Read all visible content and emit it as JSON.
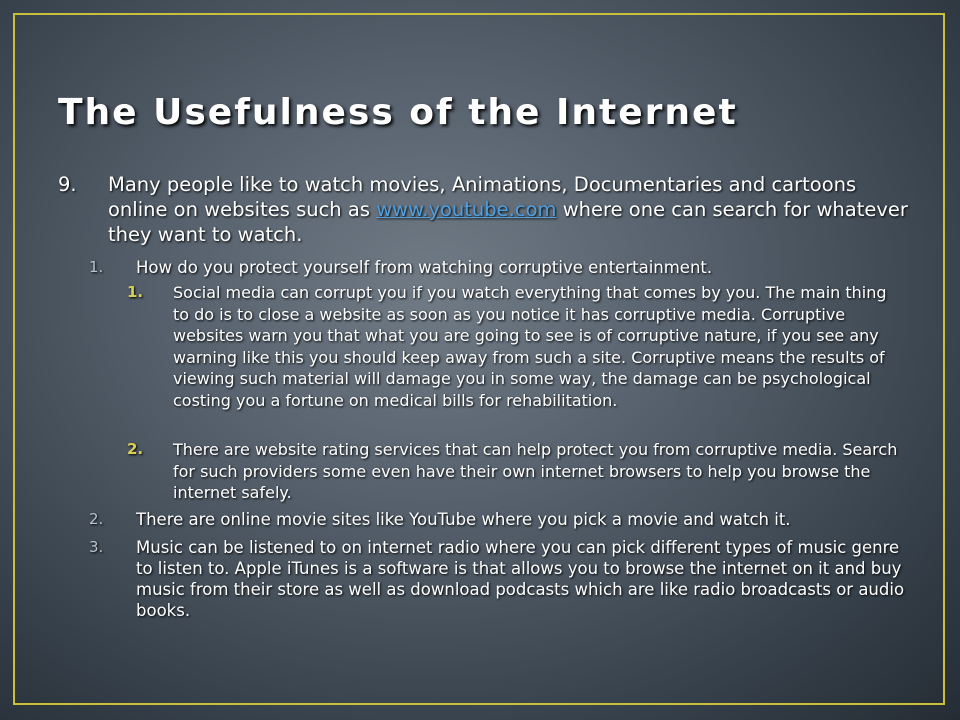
{
  "slide": {
    "title": "The Usefulness of the Internet",
    "point": {
      "number": "9.",
      "text_before": "Many people like to watch movies, Animations, Documentaries and cartoons online on websites such as ",
      "link": "www.youtube.com",
      "text_after": " where one can search for whatever they want to watch."
    },
    "sub_items": [
      {
        "number": "1.",
        "text": "How do you protect yourself from watching corruptive entertainment."
      },
      {
        "number": "2.",
        "text": "There are online movie sites like YouTube where you pick a movie and watch it."
      },
      {
        "number": "3.",
        "text": "Music can be listened to on internet radio where you can pick different types of music genre to listen to. Apple iTunes is a software is that allows you to browse the internet on it and buy music from their store as well as download podcasts which are like radio broadcasts or audio books."
      }
    ],
    "sub_sub_items": [
      {
        "number": "1.",
        "text": "Social media can corrupt you if  you watch everything that comes by you. The main thing to do is to close a website as soon as you notice it has corruptive media. Corruptive websites warn you that what you are going to see is of corruptive nature, if you see any warning like this you should keep away from such a site. Corruptive means the results of viewing such material will damage you in some way, the damage can be psychological costing you a fortune on medical bills for rehabilitation."
      },
      {
        "number": "2.",
        "text": "There are website rating services that can help protect you from corruptive media. Search for such providers some even have their own internet browsers to help you browse the internet safely."
      }
    ]
  }
}
